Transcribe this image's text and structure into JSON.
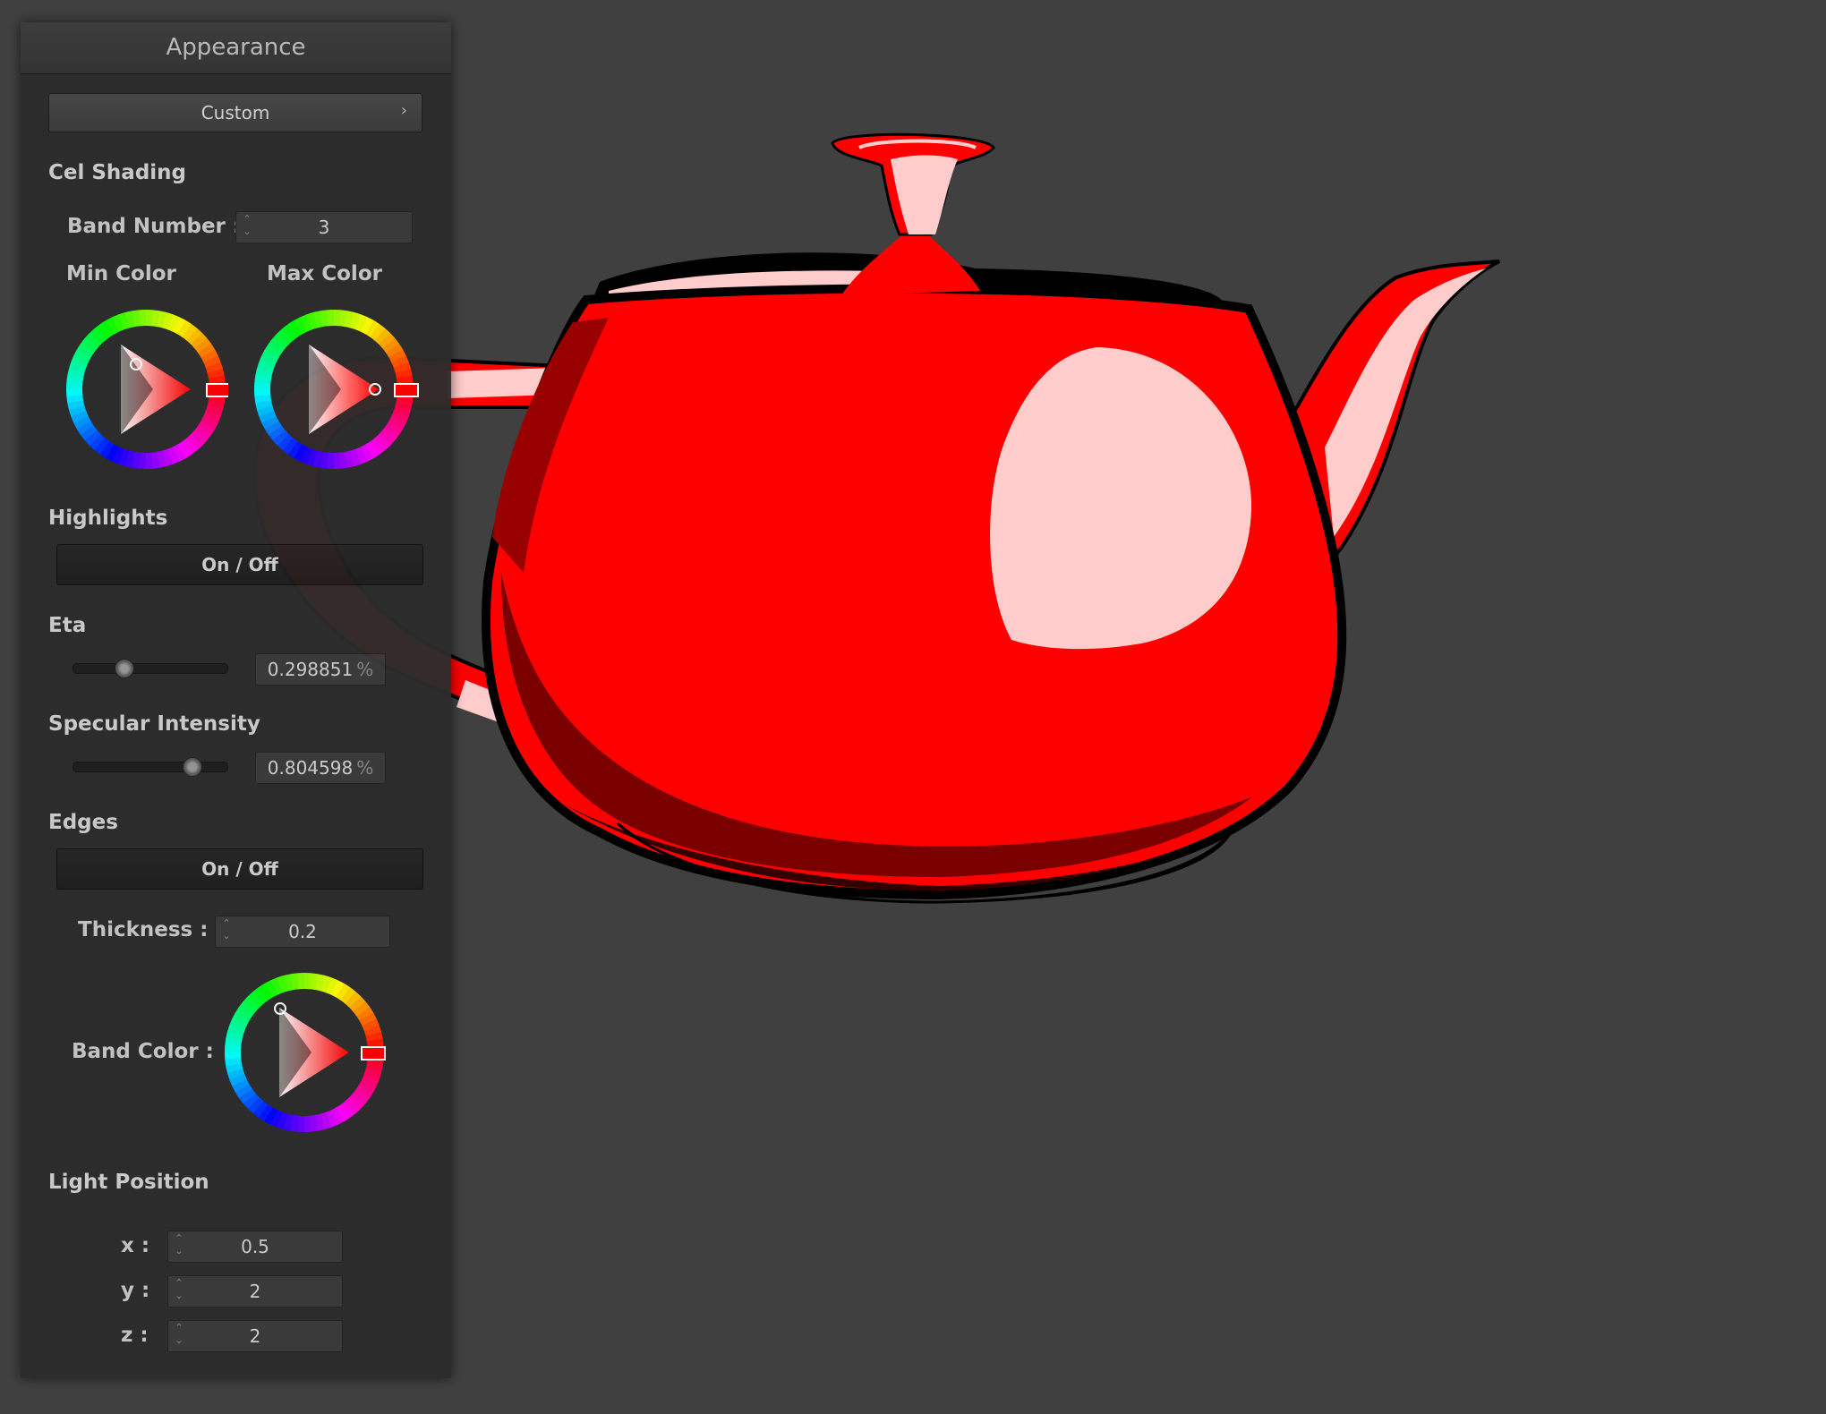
{
  "panel": {
    "title": "Appearance",
    "preset": {
      "label": "Custom",
      "chevron": "›"
    },
    "cel_shading": {
      "heading": "Cel Shading",
      "band_number_label": "Band Number :",
      "band_number_value": "3",
      "min_color_label": "Min Color",
      "max_color_label": "Max Color",
      "min_color": "#ff0000",
      "max_color": "#ff0000"
    },
    "highlights": {
      "heading": "Highlights",
      "toggle_label": "On / Off"
    },
    "eta": {
      "heading": "Eta",
      "value": "0.298851",
      "unit": "%",
      "level": 0.3
    },
    "specular": {
      "heading": "Specular Intensity",
      "value": "0.804598",
      "unit": "%",
      "level": 0.8
    },
    "edges": {
      "heading": "Edges",
      "toggle_label": "On / Off",
      "thickness_label": "Thickness :",
      "thickness_value": "0.2",
      "band_color_label": "Band Color :",
      "band_color": "#ff0000"
    },
    "light_position": {
      "heading": "Light Position",
      "x_label": "x :",
      "x_value": "0.5",
      "y_label": "y :",
      "y_value": "2",
      "z_label": "z :",
      "z_value": "2"
    }
  },
  "scene": {
    "object": "teapot",
    "colors": {
      "background": "#404040",
      "base": "#ff0000",
      "shadow": "#7a0000",
      "dark": "#330000",
      "highlight": "#ffcccc",
      "outline": "#000000"
    }
  }
}
